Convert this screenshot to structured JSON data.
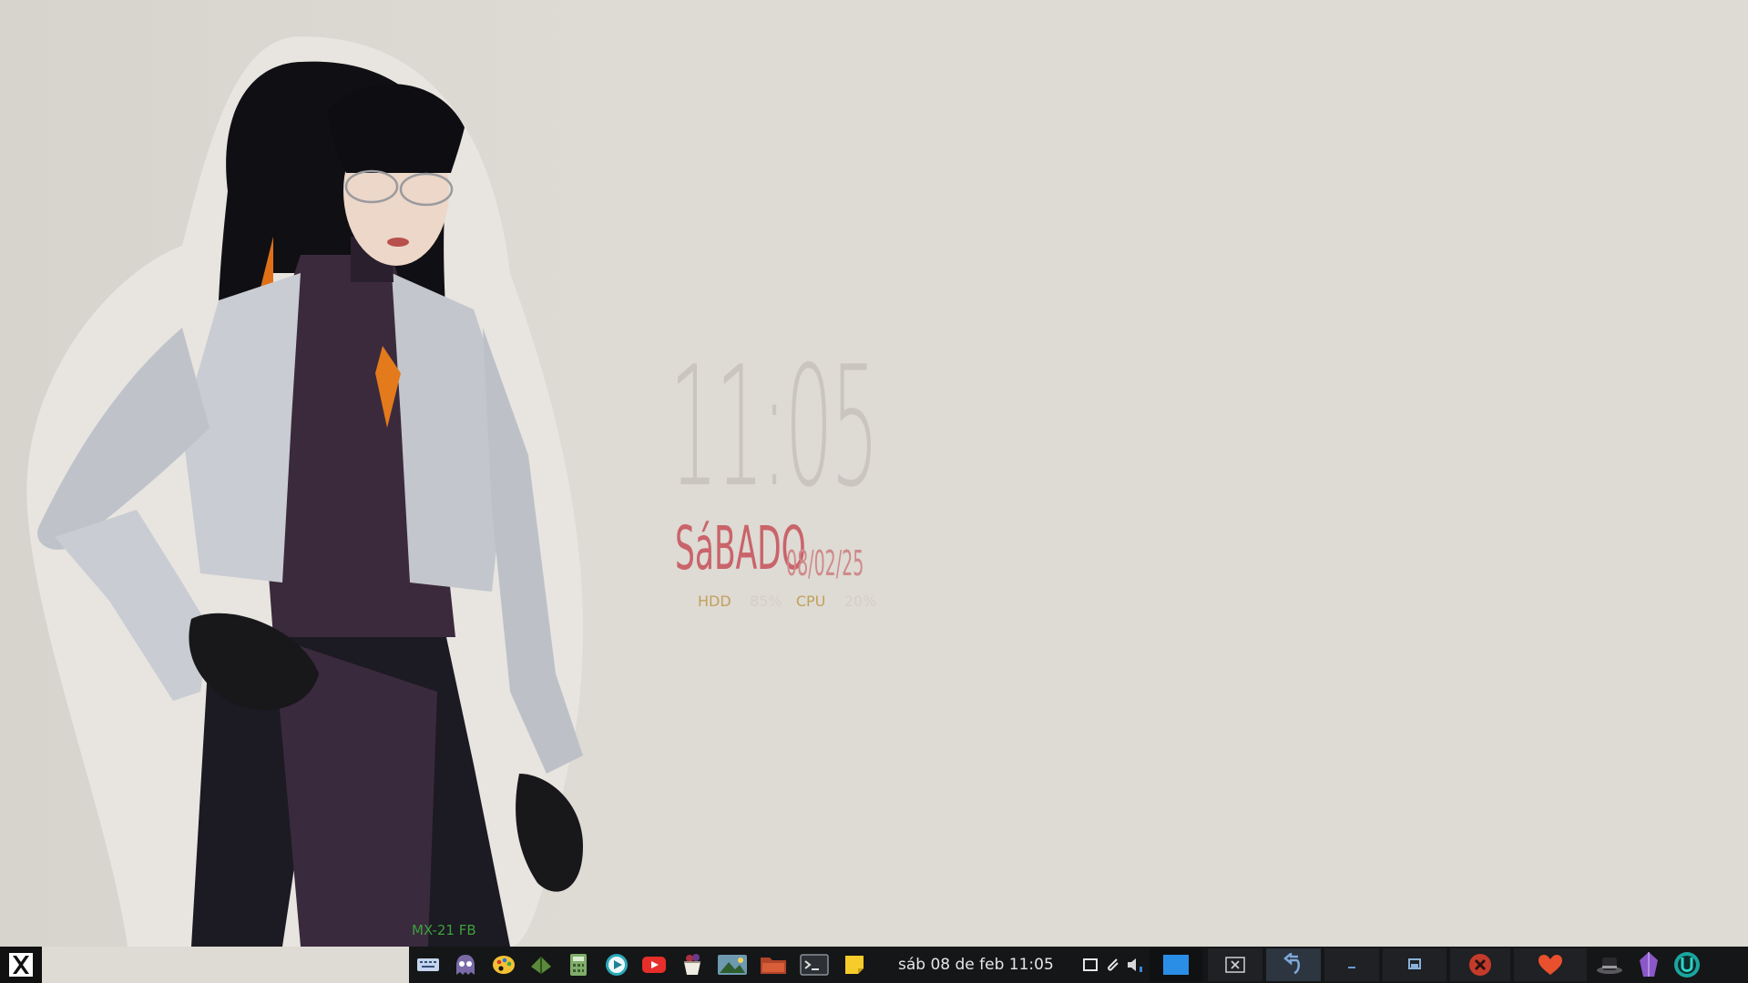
{
  "desktop": {
    "widget": {
      "time": "11:05",
      "day": "SáBADO",
      "date": "08/02/25",
      "hdd_label": "HDD",
      "hdd_value": "85%",
      "cpu_label": "CPU",
      "cpu_value": "20%"
    },
    "hostname": "MX-21 FB"
  },
  "taskbar": {
    "start_icon": "x-logo-icon",
    "launchers": [
      "keyboard-icon",
      "ghost-icon",
      "palette-icon",
      "leaf-icon",
      "calculator-icon",
      "play-circle-icon",
      "youtube-icon",
      "basket-icon",
      "image-viewer-icon",
      "folder-icon",
      "terminal-icon",
      "sticky-note-icon"
    ],
    "clock": "sáb 08 de feb 11:05",
    "tray": [
      "window-icon",
      "paperclip-icon",
      "volume-icon"
    ],
    "windows": [
      "blue-square-icon",
      "close-window-icon",
      "undo-icon",
      "minimize-icon",
      "restore-icon",
      "red-x-icon",
      "heart-icon",
      "hat-icon",
      "crystal-icon",
      "power-icon"
    ]
  },
  "colors": {
    "background": "#dedad4",
    "panel": "#151617",
    "day_text": "#c9646a",
    "sys_label": "#c1a15b",
    "hostname": "#3ca03c"
  }
}
